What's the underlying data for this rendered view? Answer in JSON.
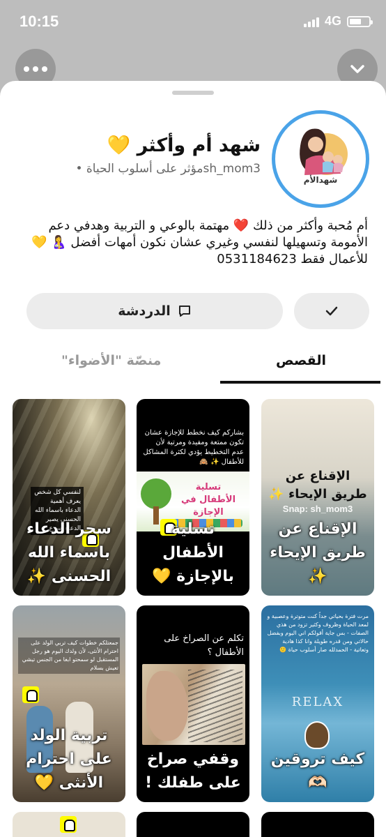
{
  "status": {
    "time": "10:15",
    "network": "4G",
    "battery_level": 0.6
  },
  "profile": {
    "name": "شهد أم وأكثر 💛",
    "username_line": "sh_mom3مؤثر على أسلوب الحياة •",
    "avatar_text": "شهدالأم",
    "bio": "أم مُحبة وأكثر من ذلك ❤️ مهتمة بالوعي و التربية وهدفي دعم الأمومة وتسهيلها لنفسي وغيري عشان نكون أمهات أفضل 🤱 💛 للأعمال فقط 0531184623"
  },
  "actions": {
    "chat_label": "الدردشة"
  },
  "tabs": {
    "stories": "القصص",
    "spotlight": "منصّة \"الأضواء\""
  },
  "stories": [
    {
      "caption": "الإقناع عن طريق الإيحاء ✨",
      "title": "الإقناع عن طريق الإيحاء ✨",
      "watermark": "Snap: sh_mom3"
    },
    {
      "caption": "تسلية الأطفال بالإجازة 💛",
      "poster_title": "تسلية الأطفال في الإجازة",
      "top_text": "بشاركم كيف نخطط للإجازة عشان تكون ممتعة ومفيدة ومرتبة لأن عدم التخطيط يؤدي لكثرة المشاكل للأطفال ✨ 🙈"
    },
    {
      "caption": "سحر الدعاء باسماء الله الحسنى ✨",
      "middle_text": "لنفسي كل شخص يعرف أهمية الدعاء باسماء الله الحسنى يصير الدعاء أسرع"
    },
    {
      "caption": "كيف تروقين 🫶🏻",
      "top_text": "مرت فترة بحياتي جداً كنت متوترة وعصبية و لمعد الحياة وظروف وكثير تزود من هذي الصفات - بس جاية أقولكم اني اليوم وبفضل حالاتي ومن قدره طويلة وانا كذا هادية وتعاتية - الحمدلله صار أسلوب حياة 🙂",
      "relax": "RELAX"
    },
    {
      "caption": "وقفي صراخ على طفلك !",
      "top_text": "تكلم عن الصراخ على الأطفال ؟"
    },
    {
      "caption": "تربية الولد على احترام الأنثى 💛",
      "top_text": "جمعتلكم خطوات كيف تربي الولد على احترام الأنثى، لأن ولدك اليوم هو رجل المستقبل لو سمحتو ابغا من الجنس تيشي تعيش بسلام"
    }
  ],
  "colors": {
    "accent": "#4aa3e8",
    "snap_yellow": "#fffc00"
  },
  "icons": [
    "more-icon",
    "chevron-down-icon",
    "chat-icon",
    "check-icon"
  ]
}
